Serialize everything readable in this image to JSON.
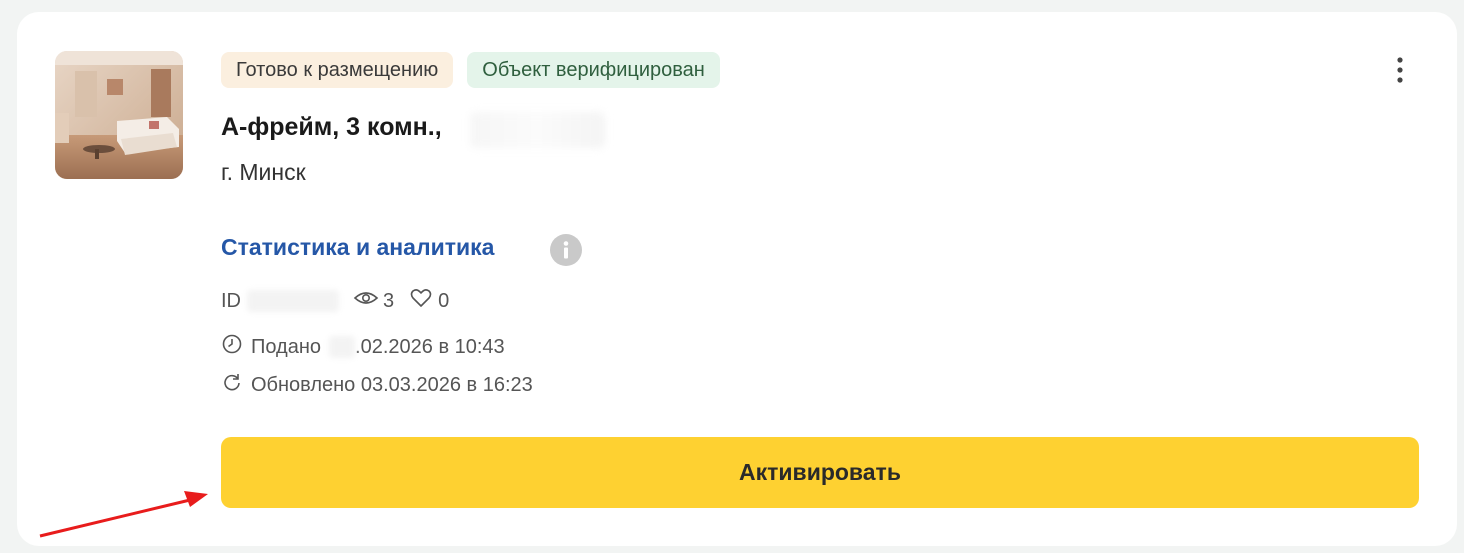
{
  "listing": {
    "badges": {
      "ready": "Готово к размещению",
      "verified": "Объект верифицирован"
    },
    "title": "А-фрейм, 3 комн.,",
    "city": "г. Минск",
    "stats_link": "Статистика и аналитика",
    "id_label": "ID",
    "views_count": "3",
    "likes_count": "0",
    "posted_label": "Подано",
    "posted_date": ".02.2026 в 10:43",
    "updated_text": "Обновлено 03.03.2026 в 16:23",
    "activate_label": "Активировать"
  },
  "colors": {
    "accent_button": "#fed131",
    "link": "#2557a7",
    "badge_ready_bg": "#fbefdf",
    "badge_verified_bg": "#e4f4ea",
    "annotation_arrow": "#e81c1c"
  },
  "icons": {
    "more": "vertical-dots-icon",
    "info": "info-icon",
    "views": "eye-icon",
    "likes": "heart-icon",
    "posted": "clock-icon",
    "updated": "refresh-icon"
  }
}
